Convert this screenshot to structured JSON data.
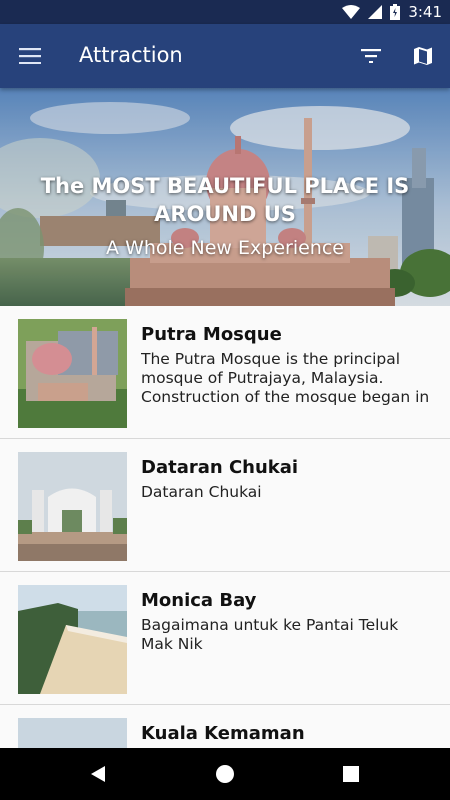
{
  "status_bar": {
    "time": "3:41"
  },
  "app_bar": {
    "title": "Attraction",
    "menu_icon": "hamburger-menu-icon",
    "filter_icon": "filter-icon",
    "map_icon": "map-icon"
  },
  "hero": {
    "title": "The MOST BEAUTIFUL PLACE IS AROUND US",
    "subtitle": "A Whole New Experience"
  },
  "attractions": [
    {
      "title": "Putra Mosque",
      "description": "The Putra Mosque is the principal mosque of Putrajaya, Malaysia. Construction of the mosque began in"
    },
    {
      "title": "Dataran Chukai",
      "description": "Dataran Chukai"
    },
    {
      "title": "Monica Bay",
      "description": "Bagaimana untuk ke Pantai Teluk Mak Nik"
    },
    {
      "title": "Kuala Kemaman",
      "description": ""
    }
  ],
  "colors": {
    "status_bar": "#1a2a52",
    "app_bar": "#27427b",
    "nav_bar": "#000000"
  }
}
